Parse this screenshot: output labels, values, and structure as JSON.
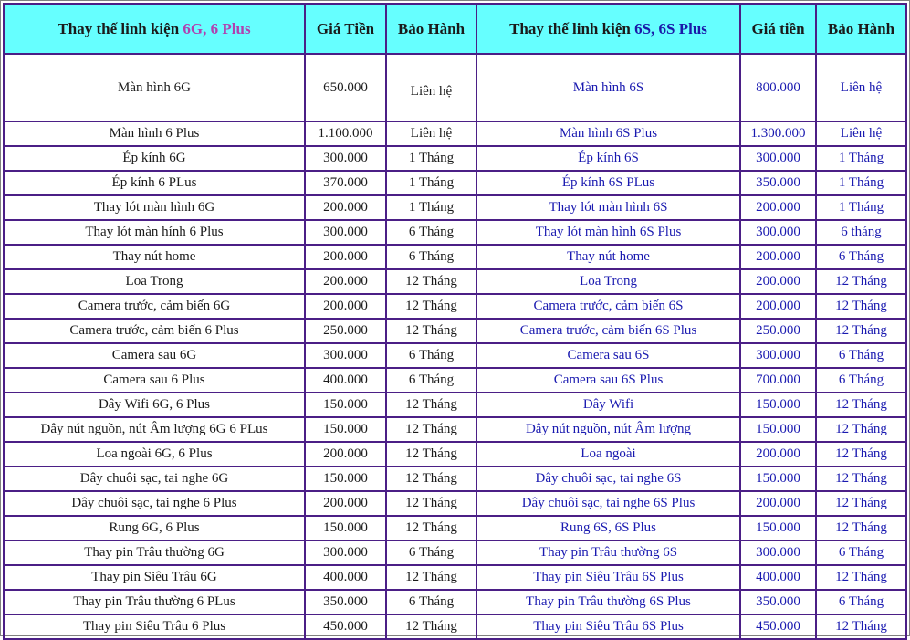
{
  "table": {
    "headers": [
      {
        "prefix": "Thay thế linh kiện ",
        "highlight": "6G, 6 Plus",
        "hl": "purple"
      },
      {
        "prefix": "Giá Tiền",
        "highlight": "",
        "hl": ""
      },
      {
        "prefix": "Bảo Hành",
        "highlight": "",
        "hl": ""
      },
      {
        "prefix": "Thay thế linh kiện ",
        "highlight": "6S, 6S Plus",
        "hl": "blue"
      },
      {
        "prefix": "Giá tiền",
        "highlight": "",
        "hl": ""
      },
      {
        "prefix": "Bảo Hành",
        "highlight": "",
        "hl": ""
      }
    ],
    "rows": [
      [
        "Màn hình 6G",
        "650.000",
        "Liên hệ",
        "Màn hình 6S",
        "800.000",
        "Liên hệ"
      ],
      [
        "Màn hình 6 Plus",
        "1.100.000",
        "Liên hệ",
        "Màn hình 6S Plus",
        "1.300.000",
        "Liên hệ"
      ],
      [
        "Ép kính 6G",
        "300.000",
        "1 Tháng",
        "Ép kính 6S",
        "300.000",
        "1 Tháng"
      ],
      [
        "Ép kính 6 PLus",
        "370.000",
        "1 Tháng",
        "Ép kính 6S PLus",
        "350.000",
        "1 Tháng"
      ],
      [
        "Thay lót màn hình 6G",
        "200.000",
        "1 Tháng",
        "Thay lót màn hình 6S",
        "200.000",
        "1 Tháng"
      ],
      [
        "Thay lót màn hính 6 Plus",
        "300.000",
        "6 Tháng",
        "Thay lót màn hình 6S Plus",
        "300.000",
        "6 tháng"
      ],
      [
        "Thay nút home",
        "200.000",
        "6 Tháng",
        "Thay nút home",
        "200.000",
        "6 Tháng"
      ],
      [
        "Loa Trong",
        "200.000",
        "12 Tháng",
        "Loa Trong",
        "200.000",
        "12 Tháng"
      ],
      [
        "Camera trước, cảm biến 6G",
        "200.000",
        "12 Tháng",
        "Camera trước, cảm biến 6S",
        "200.000",
        "12 Tháng"
      ],
      [
        "Camera trước, cảm biến 6 Plus",
        "250.000",
        "12 Tháng",
        "Camera trước, cảm biến 6S Plus",
        "250.000",
        "12 Tháng"
      ],
      [
        "Camera sau 6G",
        "300.000",
        "6 Tháng",
        "Camera sau 6S",
        "300.000",
        "6 Tháng"
      ],
      [
        "Camera sau 6 Plus",
        "400.000",
        "6 Tháng",
        "Camera sau 6S Plus",
        "700.000",
        "6 Tháng"
      ],
      [
        "Dây Wifi 6G, 6 Plus",
        "150.000",
        "12 Tháng",
        "Dây Wifi",
        "150.000",
        "12 Tháng"
      ],
      [
        "Dây nút nguồn, nút Âm lượng 6G 6 PLus",
        "150.000",
        "12 Tháng",
        "Dây nút nguồn, nút Âm lượng",
        "150.000",
        "12 Tháng"
      ],
      [
        "Loa ngoài 6G, 6 Plus",
        "200.000",
        "12 Tháng",
        "Loa ngoài",
        "200.000",
        "12 Tháng"
      ],
      [
        "Dây chuôi sạc, tai nghe 6G",
        "150.000",
        "12 Tháng",
        "Dây chuôi sạc, tai nghe 6S",
        "150.000",
        "12 Tháng"
      ],
      [
        "Dây chuôi sạc, tai nghe 6 Plus",
        "200.000",
        "12 Tháng",
        "Dây chuôi sạc, tai nghe 6S Plus",
        "200.000",
        "12 Tháng"
      ],
      [
        "Rung 6G, 6 Plus",
        "150.000",
        "12 Tháng",
        "Rung 6S, 6S Plus",
        "150.000",
        "12 Tháng"
      ],
      [
        "Thay pin Trâu thường 6G",
        "300.000",
        "6 Tháng",
        "Thay pin Trâu thường 6S",
        "300.000",
        "6 Tháng"
      ],
      [
        "Thay pin Siêu Trâu 6G",
        "400.000",
        "12 Tháng",
        "Thay pin Siêu Trâu 6S Plus",
        "400.000",
        "12 Tháng"
      ],
      [
        "Thay pin Trâu thường 6 PLus",
        "350.000",
        "6 Tháng",
        "Thay pin Trâu thường 6S Plus",
        "350.000",
        "6 Tháng"
      ],
      [
        "Thay pin Siêu Trâu 6 Plus",
        "450.000",
        "12 Tháng",
        "Thay pin Siêu Trâu 6S Plus",
        "450.000",
        "12 Tháng"
      ]
    ]
  }
}
